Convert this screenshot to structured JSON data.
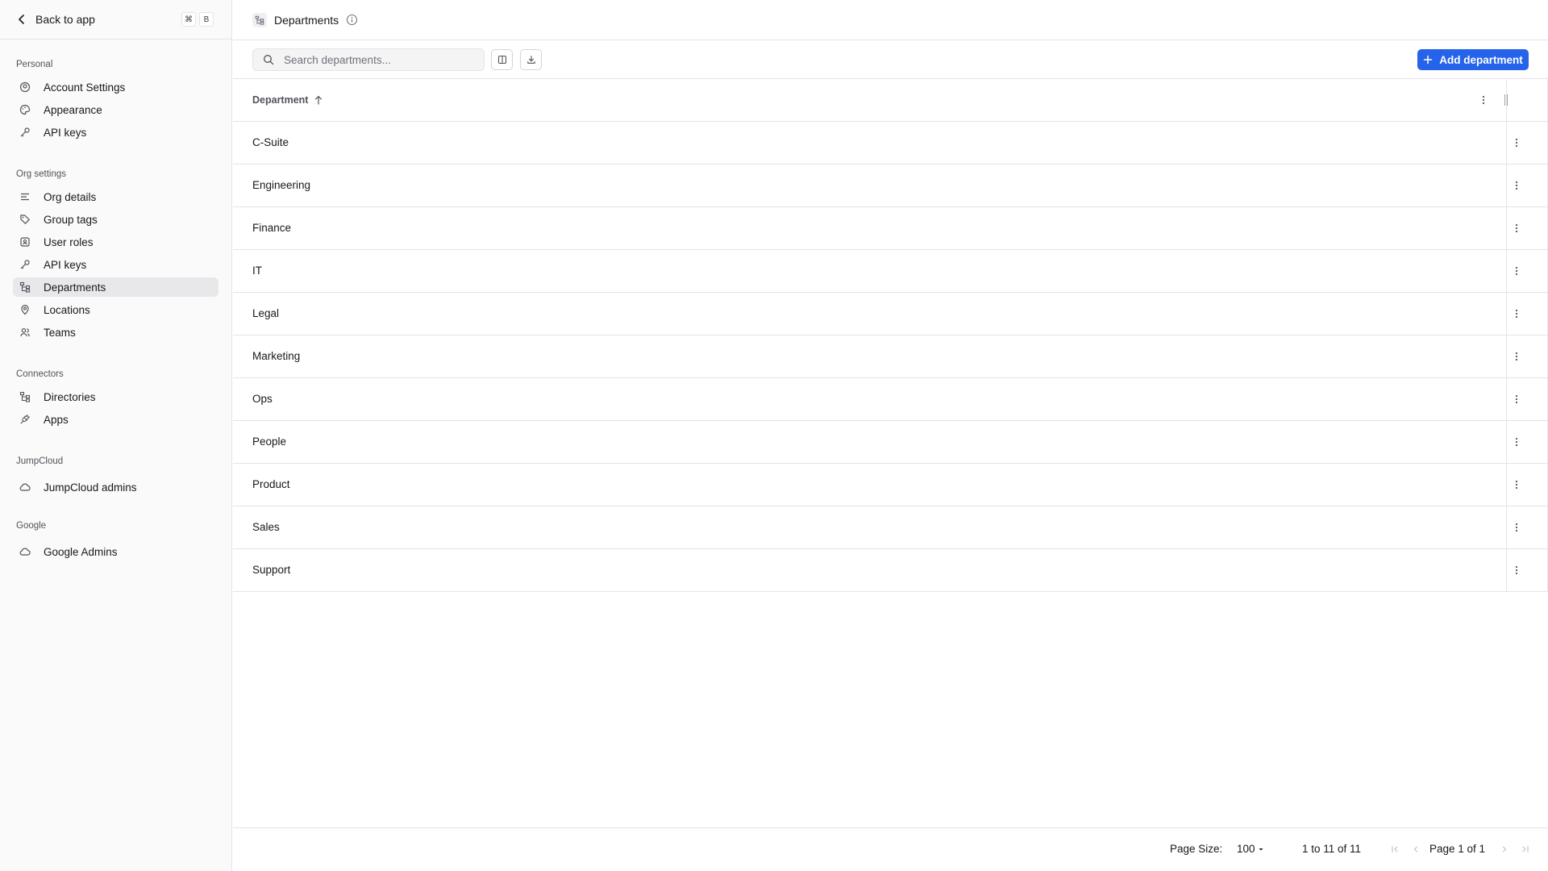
{
  "sidebar": {
    "back_label": "Back to app",
    "shortcut_keys": [
      "⌘",
      "B"
    ],
    "sections": [
      {
        "title": "Personal",
        "items": [
          {
            "label": "Account Settings",
            "icon": "user-circle-icon"
          },
          {
            "label": "Appearance",
            "icon": "palette-icon"
          },
          {
            "label": "API keys",
            "icon": "key-icon"
          }
        ]
      },
      {
        "title": "Org settings",
        "items": [
          {
            "label": "Org details",
            "icon": "lines-icon"
          },
          {
            "label": "Group tags",
            "icon": "tag-icon"
          },
          {
            "label": "User roles",
            "icon": "roles-icon"
          },
          {
            "label": "API keys",
            "icon": "key-icon"
          },
          {
            "label": "Departments",
            "icon": "hierarchy-icon",
            "active": true
          },
          {
            "label": "Locations",
            "icon": "map-pin-icon"
          },
          {
            "label": "Teams",
            "icon": "users-icon"
          }
        ]
      },
      {
        "title": "Connectors",
        "items": [
          {
            "label": "Directories",
            "icon": "hierarchy-icon"
          },
          {
            "label": "Apps",
            "icon": "plug-icon"
          }
        ]
      },
      {
        "title": "JumpCloud",
        "items": [
          {
            "label": "JumpCloud admins",
            "icon": "cloud-icon"
          }
        ]
      },
      {
        "title": "Google",
        "items": [
          {
            "label": "Google Admins",
            "icon": "cloud-icon"
          }
        ]
      }
    ]
  },
  "header": {
    "title": "Departments"
  },
  "toolbar": {
    "search_placeholder": "Search departments...",
    "add_label": "Add department"
  },
  "table": {
    "column_header": "Department",
    "rows": [
      "C-Suite",
      "Engineering",
      "Finance",
      "IT",
      "Legal",
      "Marketing",
      "Ops",
      "People",
      "Product",
      "Sales",
      "Support"
    ]
  },
  "footer": {
    "page_size_label": "Page Size:",
    "page_size_value": "100",
    "range_text": "1 to 11 of 11",
    "page_text": "Page 1 of 1"
  },
  "colors": {
    "accent": "#2563eb",
    "active_nav_bg": "#e8e8ea",
    "border": "#e4e4e7"
  }
}
